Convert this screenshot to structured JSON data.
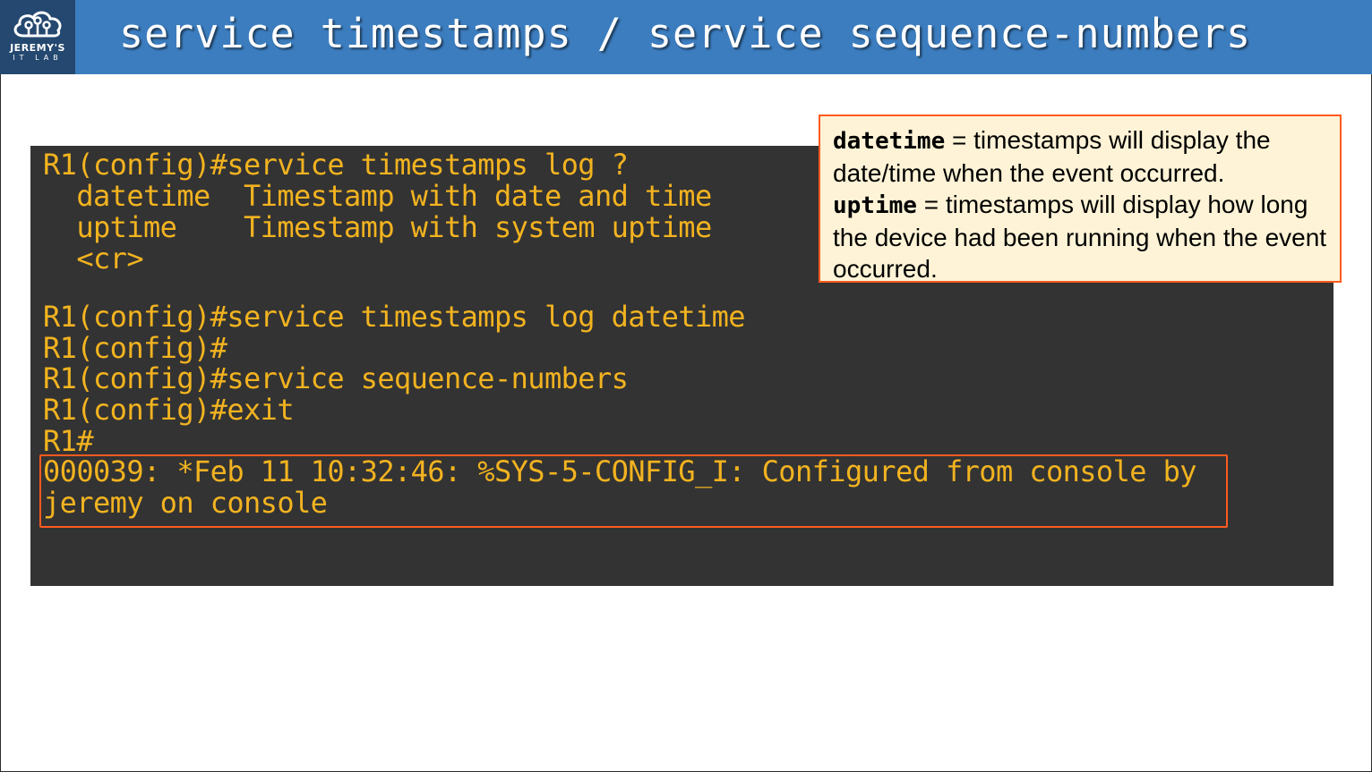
{
  "header": {
    "title": "service timestamps / service sequence-numbers",
    "logo": {
      "line1": "JEREMY'S",
      "line2": "IT LAB",
      "icon": "cloud-circuit-icon"
    },
    "colors": {
      "header_bg": "#3c7dbf",
      "logo_bg": "#24486f"
    }
  },
  "terminal": {
    "lines": [
      "R1(config)#service timestamps log ?",
      "  datetime  Timestamp with date and time",
      "  uptime    Timestamp with system uptime",
      "  <cr>",
      "",
      "R1(config)#service timestamps log datetime",
      "R1(config)#",
      "R1(config)#service sequence-numbers",
      "R1(config)#exit",
      "R1#",
      "000039: *Feb 11 10:32:46: %SYS-5-CONFIG_I: Configured from console by",
      "jeremy on console"
    ],
    "colors": {
      "bg": "#333333",
      "text": "#f2b320",
      "highlight_border": "#ff5a1f"
    }
  },
  "callout": {
    "datetime_kw": "datetime",
    "datetime_text": " = timestamps will display the date/time when the event occurred.",
    "uptime_kw": "uptime",
    "uptime_text": " = timestamps will display how long the device had been running when the event occurred.",
    "colors": {
      "bg": "#fef3d6",
      "border": "#ff5a1f"
    }
  }
}
